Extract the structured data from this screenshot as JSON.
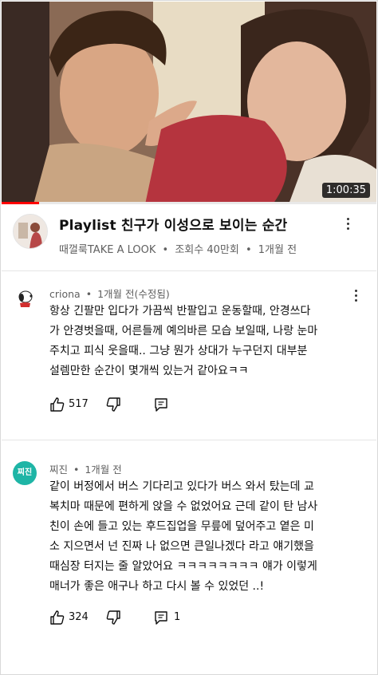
{
  "video": {
    "duration": "1:00:35",
    "progress": 0.1,
    "title": "Playlist 친구가 이성으로 보이는 순간",
    "channel": "때껄룩TAKE A LOOK",
    "views": "조회수 40만회",
    "age": "1개월 전",
    "meta_sep": "•"
  },
  "comments": [
    {
      "author": "criona",
      "time": "1개월 전(수정됨)",
      "avatar_icon": "snoopy-avatar-icon",
      "lines": [
        "항상 긴팔만 입다가 가끔씩 반팔입고 운동할때, 안경쓰다",
        "가 안경벗을때, 어른들께 예의바른 모습 보일때, 나랑 눈마",
        "주치고 피식 웃을때.. 그냥 뭔가 상대가 누구던지 대부분",
        "설렘만한 순간이 몇개씩 있는거 같아요ㅋㅋ"
      ],
      "likes": "517",
      "replies": ""
    },
    {
      "author": "찌진",
      "time": "1개월 전",
      "avatar_text": "찌진",
      "lines": [
        "같이 버정에서 버스 기다리고 있다가 버스 와서 탔는데 교",
        "복치마 때문에 편하게 앉을 수 없었어요 근데 같이 탄 남사",
        "친이 손에 들고 있는 후드집업을 무릎에 덮어주고 옅은 미",
        "소 지으면서 넌 진짜 나 없으면 큰일나겠다 라고 얘기했을",
        "때심장 터지는 줄 알았어요 ㅋㅋㅋㅋㅋㅋㅋㅋ 얘가 이렇게",
        "매너가 좋은 애구나 하고 다시 볼 수 있었던 ..!"
      ],
      "likes": "324",
      "replies": "1"
    }
  ],
  "colors": {
    "accent": "#ff0000",
    "meta": "#606060",
    "avatar_jjin": "#1eb5a6"
  }
}
